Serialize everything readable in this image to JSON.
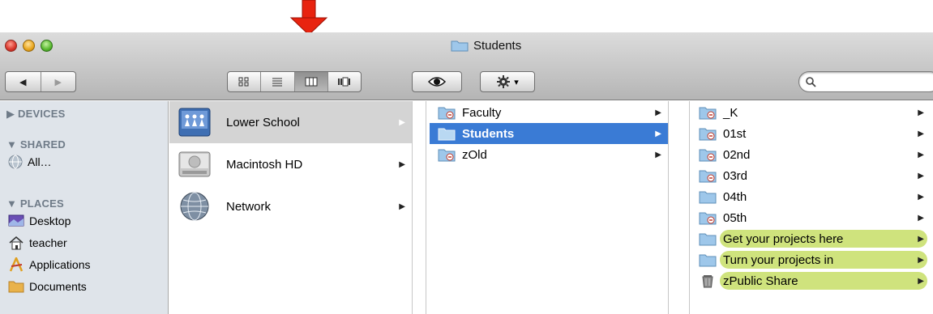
{
  "window": {
    "title": "Students"
  },
  "toolbar": {
    "back_glyph": "◀",
    "forward_glyph": "▶",
    "view_modes": [
      "icon-view",
      "list-view",
      "column-view",
      "coverflow-view"
    ],
    "active_view": "column-view",
    "gear_menu_glyph": "▾",
    "search_placeholder": ""
  },
  "sidebar": {
    "sections": [
      {
        "label": "▶ DEVICES"
      },
      {
        "label": "▼ SHARED"
      },
      {
        "label": "▼ PLACES"
      }
    ],
    "shared_items": [
      {
        "label": "All…",
        "icon": "network-globe-icon"
      }
    ],
    "places_items": [
      {
        "label": "Desktop",
        "icon": "desktop-icon"
      },
      {
        "label": "teacher",
        "icon": "home-icon"
      },
      {
        "label": "Applications",
        "icon": "applications-icon"
      },
      {
        "label": "Documents",
        "icon": "documents-folder-icon"
      }
    ]
  },
  "column1": {
    "items": [
      {
        "label": "Lower School",
        "icon": "server-volume-icon",
        "selected": true
      },
      {
        "label": "Macintosh HD",
        "icon": "hard-drive-icon",
        "selected": false
      },
      {
        "label": "Network",
        "icon": "network-globe-icon",
        "selected": false
      }
    ]
  },
  "column2": {
    "items": [
      {
        "label": "Faculty",
        "selected": false
      },
      {
        "label": "Students",
        "selected": true
      },
      {
        "label": "zOld",
        "selected": false
      }
    ]
  },
  "column3": {
    "items": [
      {
        "label": "_K",
        "badge": "no-access",
        "highlight": false
      },
      {
        "label": "01st",
        "badge": "no-access",
        "highlight": false
      },
      {
        "label": "02nd",
        "badge": "no-access",
        "highlight": false
      },
      {
        "label": "03rd",
        "badge": "no-access",
        "highlight": false
      },
      {
        "label": "04th",
        "badge": "",
        "highlight": false
      },
      {
        "label": "05th",
        "badge": "no-access",
        "highlight": false
      },
      {
        "label": "Get your projects here",
        "badge": "",
        "highlight": true
      },
      {
        "label": "Turn your projects in",
        "badge": "",
        "highlight": true
      },
      {
        "label": "zPublic Share",
        "badge": "",
        "highlight": true,
        "icon": "trash-icon"
      }
    ]
  },
  "chevron_glyph": "▶",
  "colors": {
    "selection_blue": "#3a7bd5",
    "highlight_green": "#cfe37d",
    "annotation_arrow": "#e8230f"
  }
}
